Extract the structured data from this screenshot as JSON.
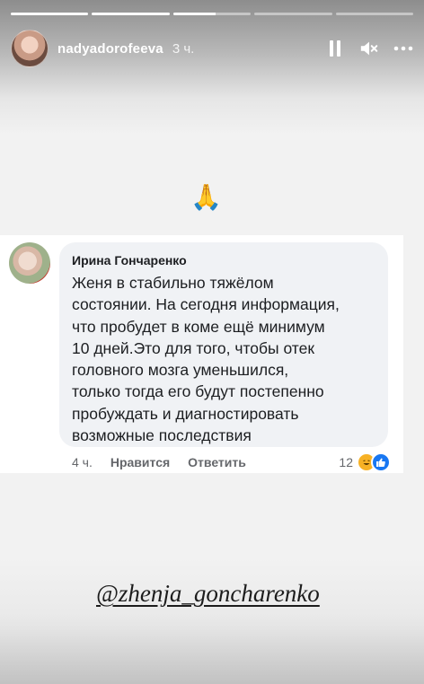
{
  "story": {
    "segments": [
      1,
      1,
      0.55,
      0,
      0
    ],
    "username": "nadyadorofeeva",
    "time": "3 ч.",
    "icons": {
      "pause": "pause-icon",
      "mute": "muted-speaker-icon",
      "more": "more-horizontal-icon"
    }
  },
  "emoji": "🙏",
  "comment": {
    "author": "Ирина Гончаренко",
    "lines": [
      "Женя в стабильно тяжёлом",
      "состоянии. На сегодня информация,",
      "что пробудет в коме ещё минимум",
      "10 дней.Это для того, чтобы отек",
      "головного мозга уменьшился,",
      "только тогда его будут постепенно",
      "пробуждать и диагностировать",
      "возможные последствия"
    ],
    "time": "4 ч.",
    "like_label": "Нравится",
    "reply_label": "Ответить",
    "reactions_count": "12",
    "reaction_icons": [
      "haha-reaction-icon",
      "like-reaction-icon"
    ]
  },
  "mention": "@zhenja_goncharenko"
}
